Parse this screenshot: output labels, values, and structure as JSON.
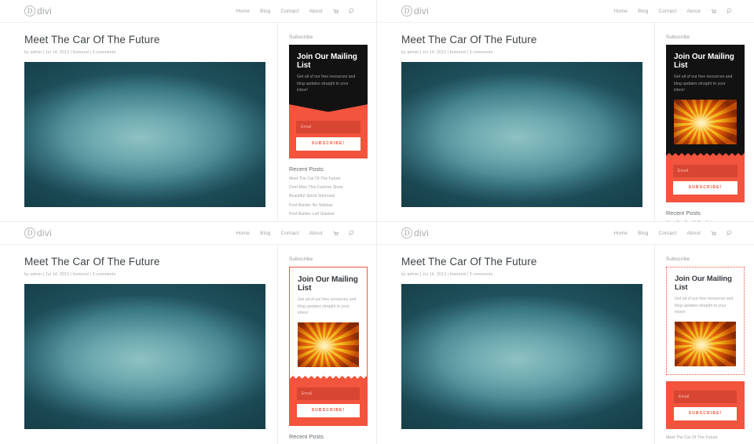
{
  "site": {
    "logo_letter": "D",
    "logo_text": "divi",
    "nav": [
      {
        "label": "Home",
        "name": "home"
      },
      {
        "label": "Blog",
        "name": "blog"
      },
      {
        "label": "Contact",
        "name": "contact"
      },
      {
        "label": "About",
        "name": "about"
      }
    ],
    "cart_icon": "cart-icon",
    "search_icon": "search-icon"
  },
  "post": {
    "title": "Meet The Car Of The Future",
    "meta": "by admin | Jul 14, 2013 | featured | 3 comments",
    "photo_alt": "teal agave succulent close-up"
  },
  "sidebar": {
    "subscribe_label": "Subscribe",
    "recent_label": "Recent Posts",
    "recent_posts": [
      "Meet The Car Of The Future",
      "Dont Miss This Fashion Show",
      "Beautiful Spiral Staircase",
      "Post Builder No Sidebar",
      "Post Builder Left Sidebar"
    ],
    "recent_posts_short": [
      "Meet The Car Of The Future"
    ]
  },
  "optin": {
    "heading": "Join Our Mailing List",
    "body": "Get all of our free resources and blog updates straight to your inbox!",
    "email_placeholder": "Email",
    "button_label": "SUBSCRIBE!",
    "image_alt": "orange spiral flower"
  },
  "colors": {
    "accent": "#f2543d",
    "accent_dark": "#d84633",
    "panel_dark": "#121212",
    "text": "#3d4347",
    "muted": "#9aa0a5"
  },
  "variants": [
    {
      "id": "A",
      "name": "black-panel-v-notch",
      "divider": "v-notch",
      "has_image": false,
      "panel": "dark"
    },
    {
      "id": "B",
      "name": "black-panel-sawtooth",
      "divider": "sawtooth",
      "has_image": true,
      "panel": "dark"
    },
    {
      "id": "C",
      "name": "white-panel-framed",
      "divider": "sawtooth",
      "has_image": true,
      "panel": "light"
    },
    {
      "id": "D",
      "name": "dotted-border-split",
      "divider": "none",
      "has_image": true,
      "panel": "light"
    }
  ]
}
